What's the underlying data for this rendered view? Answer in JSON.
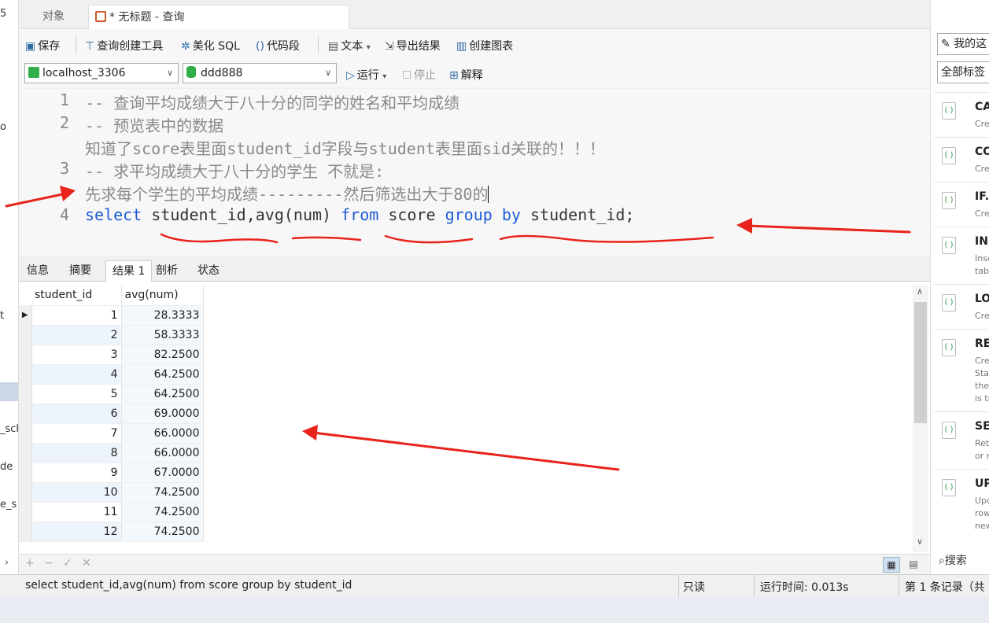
{
  "left_panel": {
    "items": [
      "5",
      "o",
      "t",
      "_sch",
      "de",
      "e_s"
    ]
  },
  "tabs": [
    {
      "label": "对象"
    },
    {
      "label": "* 无标题 - 查询"
    }
  ],
  "toolbar": {
    "save": "保存",
    "query_builder": "查询创建工具",
    "beautify": "美化 SQL",
    "snippet": "代码段",
    "text": "文本",
    "export": "导出结果",
    "chart": "创建图表"
  },
  "connection": {
    "server": "localhost_3306",
    "database": "ddd888",
    "run": "运行",
    "stop": "停止",
    "explain": "解释"
  },
  "editor": {
    "line_numbers": [
      "1",
      "2",
      "3",
      "4"
    ],
    "lines": [
      "-- 查询平均成绩大于八十分的同学的姓名和平均成绩",
      "-- 预览表中的数据",
      "知道了score表里面student_id字段与student表里面sid关联的！！！",
      "-- 求平均成绩大于八十分的学生 不就是:",
      "先求每个学生的平均成绩---------然后筛选出大于80的"
    ],
    "sql_tokens": {
      "k1": "select",
      "p1": " student_id,avg(num) ",
      "k2": "from",
      "p2": " score ",
      "k3": "group",
      "p3": " ",
      "k4": "by",
      "p4": " student_id;"
    }
  },
  "result_tabs": [
    {
      "label": "信息"
    },
    {
      "label": "摘要"
    },
    {
      "label": "结果 1"
    },
    {
      "label": "剖析"
    },
    {
      "label": "状态"
    }
  ],
  "grid": {
    "columns": [
      "student_id",
      "avg(num)"
    ],
    "rows": [
      [
        "1",
        "28.3333"
      ],
      [
        "2",
        "58.3333"
      ],
      [
        "3",
        "82.2500"
      ],
      [
        "4",
        "64.2500"
      ],
      [
        "5",
        "64.2500"
      ],
      [
        "6",
        "69.0000"
      ],
      [
        "7",
        "66.0000"
      ],
      [
        "8",
        "66.0000"
      ],
      [
        "9",
        "67.0000"
      ],
      [
        "10",
        "74.2500"
      ],
      [
        "11",
        "74.2500"
      ],
      [
        "12",
        "74.2500"
      ]
    ]
  },
  "grid_toolbar": {
    "add": "+",
    "remove": "−",
    "apply": "✓",
    "discard": "✕"
  },
  "status_bar": {
    "sql": "select student_id,avg(num) from score group by student_id",
    "mode": "只读",
    "time": "运行时间: 0.013s",
    "record": "第 1 条记录（共"
  },
  "right_panel": {
    "button1": "我的这",
    "button2": "全部标签",
    "search": "搜索",
    "snippets": [
      {
        "title": "CA",
        "desc": [
          "Cre"
        ]
      },
      {
        "title": "CO",
        "desc": [
          "Cre"
        ]
      },
      {
        "title": "IF.",
        "desc": [
          "Cre"
        ]
      },
      {
        "title": "IN",
        "desc": [
          "Inse",
          "tab"
        ]
      },
      {
        "title": "LO",
        "desc": [
          "Cre"
        ]
      },
      {
        "title": "RE",
        "desc": [
          "Cre",
          "Sta",
          "the",
          "is tr"
        ]
      },
      {
        "title": "SE",
        "desc": [
          "Ret",
          "or r"
        ]
      },
      {
        "title": "UP",
        "desc": [
          "Upd",
          "row",
          "new"
        ]
      }
    ]
  },
  "annotation_color": "#e8231c"
}
